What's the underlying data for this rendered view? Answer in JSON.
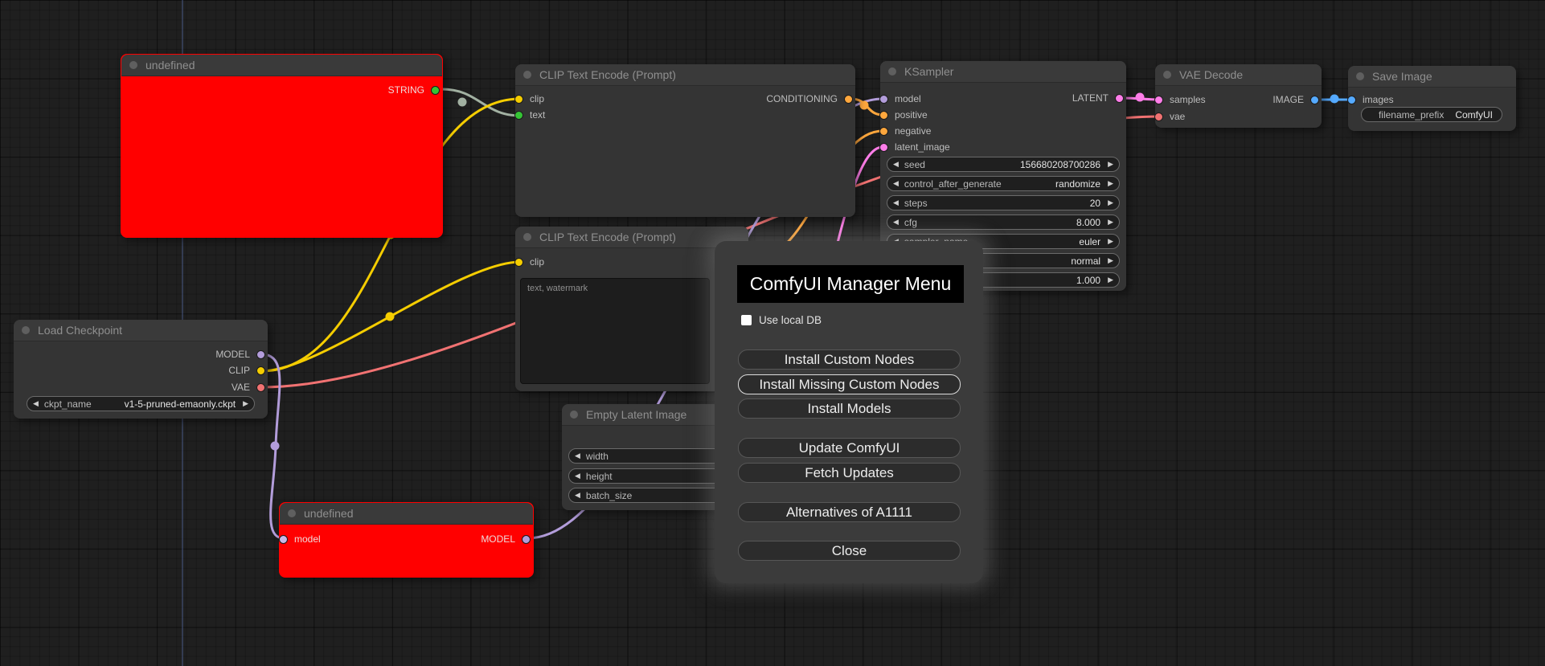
{
  "nodes": {
    "undefined_top": {
      "title": "undefined",
      "outputs": [
        "STRING"
      ]
    },
    "clip_encode_1": {
      "title": "CLIP Text Encode (Prompt)",
      "inputs": [
        "clip",
        "text"
      ],
      "outputs": [
        "CONDITIONING"
      ]
    },
    "clip_encode_2": {
      "title": "CLIP Text Encode (Prompt)",
      "inputs": [
        "clip"
      ],
      "text_value": "text, watermark"
    },
    "empty_latent": {
      "title": "Empty Latent Image",
      "widgets": [
        {
          "name": "width",
          "value": ""
        },
        {
          "name": "height",
          "value": ""
        },
        {
          "name": "batch_size",
          "value": ""
        }
      ]
    },
    "ksampler": {
      "title": "KSampler",
      "inputs": [
        "model",
        "positive",
        "negative",
        "latent_image"
      ],
      "outputs": [
        "LATENT"
      ],
      "widgets": [
        {
          "name": "seed",
          "value": "156680208700286"
        },
        {
          "name": "control_after_generate",
          "value": "randomize"
        },
        {
          "name": "steps",
          "value": "20"
        },
        {
          "name": "cfg",
          "value": "8.000"
        },
        {
          "name": "sampler_name",
          "value": "euler"
        },
        {
          "name": "",
          "value": "normal"
        },
        {
          "name": "",
          "value": "1.000"
        }
      ]
    },
    "load_checkpoint": {
      "title": "Load Checkpoint",
      "outputs": [
        "MODEL",
        "CLIP",
        "VAE"
      ],
      "widgets": [
        {
          "name": "ckpt_name",
          "value": "v1-5-pruned-emaonly.ckpt"
        }
      ]
    },
    "vae_decode": {
      "title": "VAE Decode",
      "inputs": [
        "samples",
        "vae"
      ],
      "outputs": [
        "IMAGE"
      ]
    },
    "save_image": {
      "title": "Save Image",
      "inputs": [
        "images"
      ],
      "widgets": [
        {
          "name": "filename_prefix",
          "value": "ComfyUI"
        }
      ]
    },
    "undefined_bottom": {
      "title": "undefined",
      "inputs": [
        "model"
      ],
      "outputs": [
        "MODEL"
      ]
    }
  },
  "menu": {
    "title": "ComfyUI Manager Menu",
    "checkbox_label": "Use local DB",
    "checkbox_checked": false,
    "buttons": [
      "Install Custom Nodes",
      "Install Missing Custom Nodes",
      "Install Models",
      "Update ComfyUI",
      "Fetch Updates",
      "Alternatives of A1111",
      "Close"
    ],
    "highlighted_button": "Install Missing Custom Nodes"
  },
  "glyphs": {
    "arrow_left": "◀",
    "arrow_right": "▶"
  },
  "colors": {
    "model": "#b39ddb",
    "clip": "#f5cd00",
    "vae": "#f17272",
    "conditioning": "#ffa73d",
    "latent": "#ff7ee9",
    "image": "#55aaff",
    "string": "#35c435",
    "error_node": "#ff0000",
    "menu_bg": "#3b3b3b",
    "node_bg": "#343434",
    "canvas_bg": "#1f1f1f"
  }
}
